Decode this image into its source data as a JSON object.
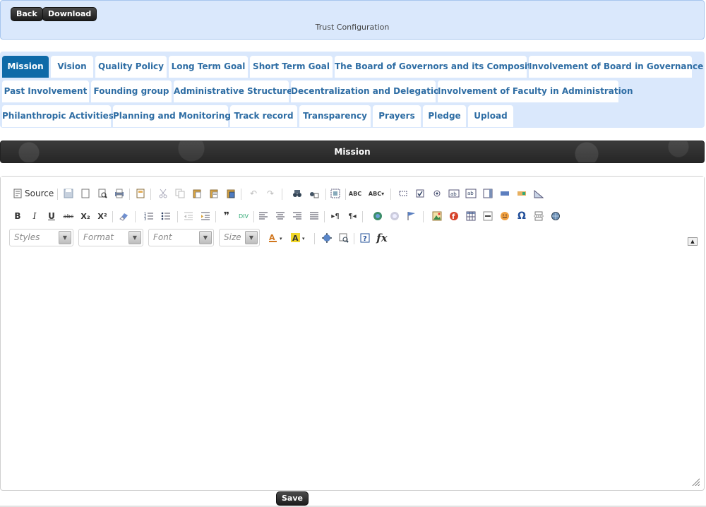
{
  "header": {
    "back_label": "Back",
    "download_label": "Download",
    "title": "Trust Configuration"
  },
  "tabs": [
    {
      "label": "Mission",
      "active": true
    },
    {
      "label": "Vision"
    },
    {
      "label": "Quality Policy"
    },
    {
      "label": "Long Term Goal"
    },
    {
      "label": "Short Term Goal"
    },
    {
      "label": "The Board of Governors and its Composition"
    },
    {
      "label": "Involvement of Board in Governance"
    },
    {
      "label": "Past Involvement"
    },
    {
      "label": "Founding group"
    },
    {
      "label": "Administrative Structure"
    },
    {
      "label": "Decentralization and Delegation"
    },
    {
      "label": "Involvement of Faculty in Administration"
    },
    {
      "label": "Philanthropic Activities"
    },
    {
      "label": "Planning and Monitoring"
    },
    {
      "label": "Track record"
    },
    {
      "label": "Transparency"
    },
    {
      "label": "Prayers"
    },
    {
      "label": "Pledge"
    },
    {
      "label": "Upload"
    }
  ],
  "section": {
    "title": "Mission"
  },
  "editor": {
    "source_label": "Source",
    "styles_placeholder": "Styles",
    "format_placeholder": "Format",
    "font_placeholder": "Font",
    "size_placeholder": "Size",
    "bold_glyph": "B",
    "italic_glyph": "I",
    "underline_glyph": "U",
    "strike_glyph": "abc",
    "subscript_glyph": "X₂",
    "superscript_glyph": "X²",
    "omega_glyph": "Ω",
    "fx_glyph": "fx",
    "help_glyph": "?",
    "content": ""
  },
  "footer": {
    "save_label": "Save"
  },
  "colors": {
    "panel_bg": "#dae8fc",
    "active_tab": "#0e6aa8",
    "tab_text": "#2e6da4",
    "dark_button": "#1c1c1c"
  }
}
